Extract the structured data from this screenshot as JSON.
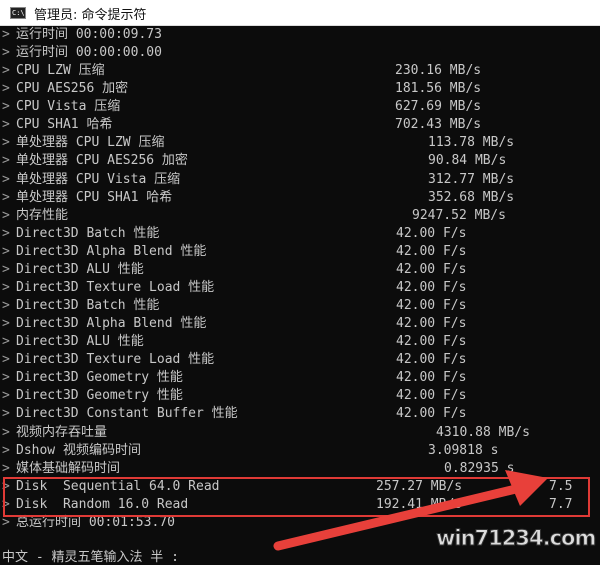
{
  "window": {
    "title": "管理员: 命令提示符",
    "icon": "cmd-icon",
    "icon_text": "C:\\"
  },
  "prompt_char": ">",
  "lines": [
    {
      "label": "运行时间 00:00:09.73",
      "value": ""
    },
    {
      "label": "运行时间 00:00:00.00",
      "value": ""
    },
    {
      "label": "CPU LZW 压缩",
      "value": "230.16 MB/s"
    },
    {
      "label": "CPU AES256 加密",
      "value": "181.56 MB/s"
    },
    {
      "label": "CPU Vista 压缩",
      "value": "627.69 MB/s"
    },
    {
      "label": "CPU SHA1 哈希",
      "value": "702.43 MB/s"
    },
    {
      "label": "单处理器 CPU LZW 压缩",
      "value": "113.78 MB/s"
    },
    {
      "label": "单处理器 CPU AES256 加密",
      "value": "90.84 MB/s"
    },
    {
      "label": "单处理器 CPU Vista 压缩",
      "value": "312.77 MB/s"
    },
    {
      "label": "单处理器 CPU SHA1 哈希",
      "value": "352.68 MB/s"
    },
    {
      "label": "内存性能",
      "value": "9247.52 MB/s"
    },
    {
      "label": "Direct3D Batch 性能",
      "value": "42.00 F/s"
    },
    {
      "label": "Direct3D Alpha Blend 性能",
      "value": "42.00 F/s"
    },
    {
      "label": "Direct3D ALU 性能",
      "value": "42.00 F/s"
    },
    {
      "label": "Direct3D Texture Load 性能",
      "value": "42.00 F/s"
    },
    {
      "label": "Direct3D Batch 性能",
      "value": "42.00 F/s"
    },
    {
      "label": "Direct3D Alpha Blend 性能",
      "value": "42.00 F/s"
    },
    {
      "label": "Direct3D ALU 性能",
      "value": "42.00 F/s"
    },
    {
      "label": "Direct3D Texture Load 性能",
      "value": "42.00 F/s"
    },
    {
      "label": "Direct3D Geometry 性能",
      "value": "42.00 F/s"
    },
    {
      "label": "Direct3D Geometry 性能",
      "value": "42.00 F/s"
    },
    {
      "label": "Direct3D Constant Buffer 性能",
      "value": "42.00 F/s"
    },
    {
      "label": "视频内存吞吐量",
      "value": "4310.88 MB/s"
    },
    {
      "label": "Dshow 视频编码时间",
      "value": "3.09818 s"
    },
    {
      "label": "媒体基础解码时间",
      "value": "0.82935 s"
    },
    {
      "label": "Disk  Sequential 64.0 Read",
      "value": "257.27 MB/s",
      "score": "7.5"
    },
    {
      "label": "Disk  Random 16.0 Read",
      "value": "192.41 MB/s",
      "score": "7.7"
    },
    {
      "label": "总运行时间 00:01:53.70",
      "value": ""
    }
  ],
  "ime_status": "中文 - 精灵五笔输入法 半 :",
  "annotation": {
    "highlight_color": "#e03a36",
    "arrow_color": "#e8403a"
  },
  "watermark": "win71234.com"
}
